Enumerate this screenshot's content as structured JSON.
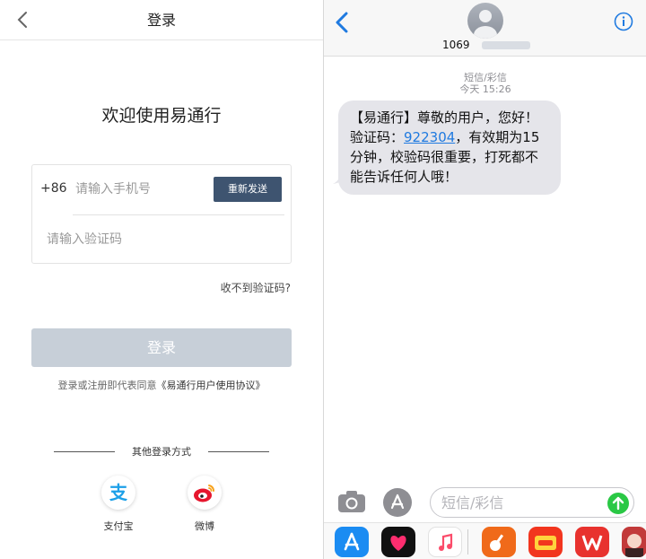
{
  "left": {
    "nav": {
      "title": "登录"
    },
    "welcome": "欢迎使用易通行",
    "form": {
      "country_code": "+86",
      "phone_placeholder": "请输入手机号",
      "resend_label": "重新发送",
      "code_placeholder": "请输入验证码"
    },
    "no_code_link": "收不到验证码?",
    "login_button": "登录",
    "agreement_prefix": "登录或注册即代表同意",
    "agreement_link": "《易通行用户使用协议》",
    "other_login_title": "其他登录方式",
    "social": [
      {
        "label": "支付宝",
        "icon": "alipay-icon",
        "glyph": "支"
      },
      {
        "label": "微博",
        "icon": "weibo-icon"
      }
    ]
  },
  "right": {
    "sender_prefix": "1069",
    "message_type": "短信/彩信",
    "message_time": "今天 15:26",
    "message": {
      "before": "【易通行】尊敬的用户，您好！验证码：",
      "code": "922304",
      "after": "，有效期为15分钟，校验码很重要，打死都不能告诉任何人哦！"
    },
    "input_placeholder": "短信/彩信",
    "apps": [
      {
        "icon": "app-store-icon",
        "color": "#1b8cf2"
      },
      {
        "icon": "heart-app-icon",
        "color": "#111111"
      },
      {
        "icon": "music-icon",
        "color": "#ffffff"
      },
      {
        "icon": "guitar-app-icon",
        "color": "#f06a1a"
      },
      {
        "icon": "suning-app-icon",
        "color": "#f2351e"
      },
      {
        "icon": "wps-app-icon",
        "color": "#e8322e"
      },
      {
        "icon": "photo-app-icon",
        "color": "#c23a3a"
      }
    ],
    "colors": {
      "accent": "#1f7ae0",
      "send": "#2ac845",
      "bubble": "#e5e5ea"
    }
  }
}
